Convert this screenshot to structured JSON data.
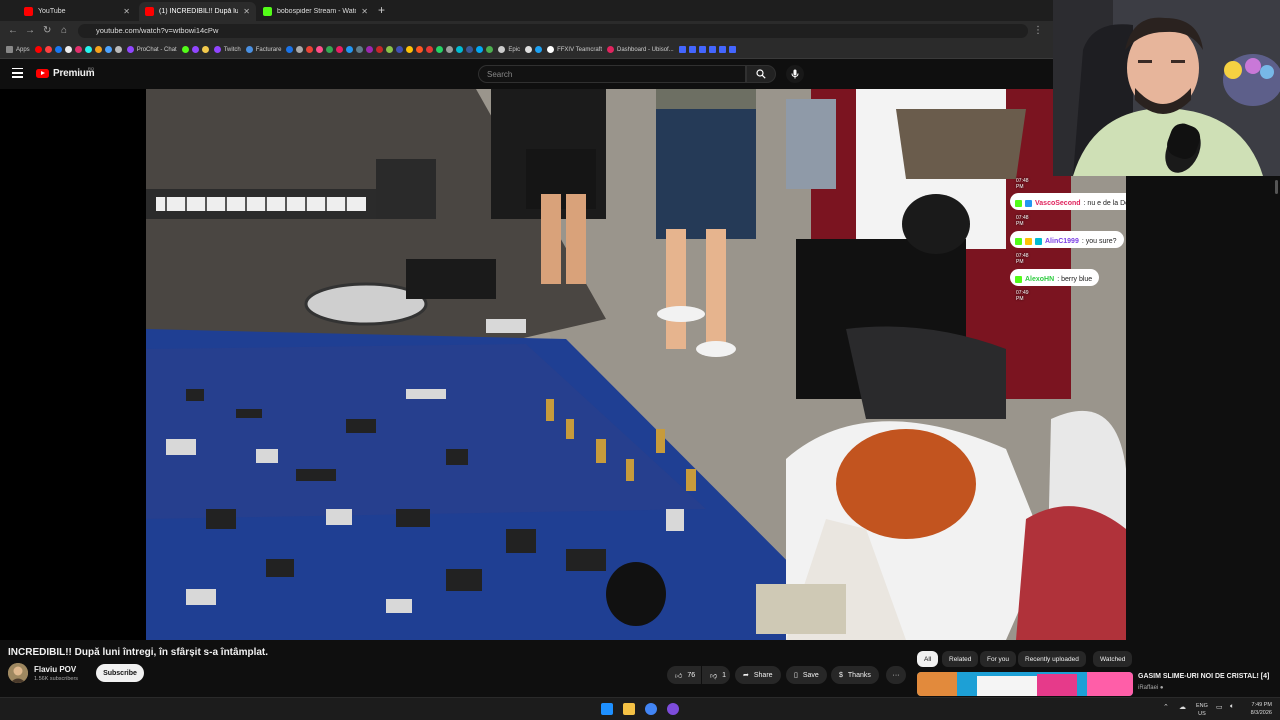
{
  "browser": {
    "tabs": [
      {
        "label": "YouTube",
        "active": false,
        "color": "#ff0000"
      },
      {
        "label": "(1) INCREDIBIL!! După luni î",
        "active": true,
        "color": "#ff0000"
      },
      {
        "label": "bobospider Stream - Watch Li",
        "active": false,
        "color": "#53fc18"
      }
    ],
    "new_tab": "+",
    "url": "youtube.com/watch?v=wtbowi14cPw",
    "bookmarks": [
      {
        "label": "Apps",
        "color": "#888888"
      },
      {
        "label": "ProChat - Chat",
        "color": "#9146ff"
      },
      {
        "label": "Twitch",
        "color": "#9146ff"
      },
      {
        "label": "Facturare",
        "color": "#4a90e2"
      },
      {
        "label": "Epic",
        "color": "#cccccc"
      },
      {
        "label": "FFXIV Teamcraft",
        "color": "#ffffff"
      },
      {
        "label": "Dashboard - Ubisof...",
        "color": "#e0245e"
      }
    ]
  },
  "youtube": {
    "logo_text": "Premium",
    "logo_sup": "RO",
    "search_placeholder": "Search",
    "video": {
      "title": "INCREDIBIL!! După luni întregi, în sfârșit s-a întâmplat.",
      "channel_name": "Flaviu POV",
      "subscribers": "1.56K subscribers",
      "subscribe_label": "Subscribe",
      "likes": "76",
      "dislikes": "1",
      "share_label": "Share",
      "save_label": "Save",
      "thanks_label": "Thanks",
      "more_label": "···"
    },
    "chips": [
      {
        "label": "All",
        "active": true
      },
      {
        "label": "Related",
        "active": false
      },
      {
        "label": "For you",
        "active": false
      },
      {
        "label": "Recently uploaded",
        "active": false
      },
      {
        "label": "Watched",
        "active": false
      }
    ],
    "recommendation": {
      "title": "GASIM SLIME-URI NOI DE CRISTAL! [4]",
      "channel": "iRaffaei"
    }
  },
  "chat": [
    {
      "time": "07:48 PM",
      "user": "VascoSecond",
      "user_color": "#e0245e",
      "message": ": nu e de la Destiny ?"
    },
    {
      "time": "07:48 PM",
      "user": "AlinC1999",
      "user_color": "#7b3fe4",
      "message": ": you sure?"
    },
    {
      "time": "07:48 PM",
      "user": "AlexoHN",
      "user_color": "#2ecc40",
      "message": ": berry blue"
    },
    {
      "time": "07:49 PM"
    }
  ],
  "taskbar": {
    "lang": "ENG",
    "region": "US",
    "time": "7:49 PM",
    "date": "8/3/2026"
  }
}
